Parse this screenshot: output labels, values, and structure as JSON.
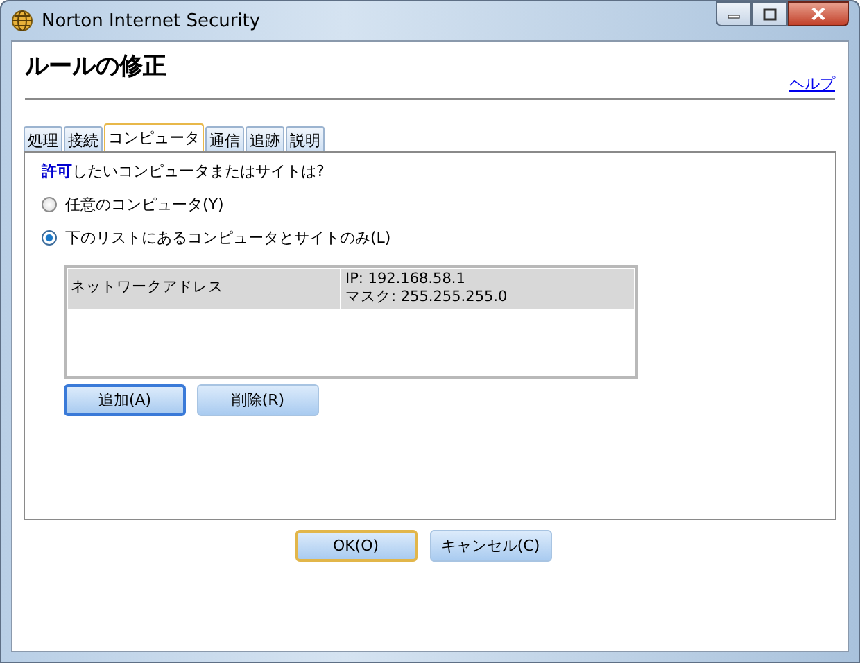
{
  "window": {
    "title": "Norton Internet Security"
  },
  "heading": "ルールの修正",
  "help_link": "ヘルプ",
  "tabs": [
    {
      "label": "処理",
      "selected": false
    },
    {
      "label": "接続",
      "selected": false
    },
    {
      "label": "コンピュータ",
      "selected": true
    },
    {
      "label": "通信",
      "selected": false
    },
    {
      "label": "追跡",
      "selected": false
    },
    {
      "label": "説明",
      "selected": false
    }
  ],
  "question": "**許可**したいコンピュータまたはサイトは?",
  "options": [
    {
      "label": "任意のコンピュータ(Y)",
      "selected": false
    },
    {
      "label": "下のリストにあるコンピュータとサイトのみ(L)",
      "selected": true
    }
  ],
  "list": {
    "rows": [
      {
        "type": "ネットワークアドレス",
        "address": [
          "IP: 192.168.58.1",
          "マスク: 255.255.255.0"
        ],
        "selected": true
      }
    ]
  },
  "list_buttons": [
    {
      "label": "追加(A)",
      "focused": true,
      "default": false
    },
    {
      "label": "削除(R)",
      "focused": false,
      "default": false
    }
  ],
  "footer_buttons": [
    {
      "label": "OK(O)",
      "focused": false,
      "default": true
    },
    {
      "label": "キャンセル(C)",
      "focused": false,
      "default": false
    }
  ]
}
